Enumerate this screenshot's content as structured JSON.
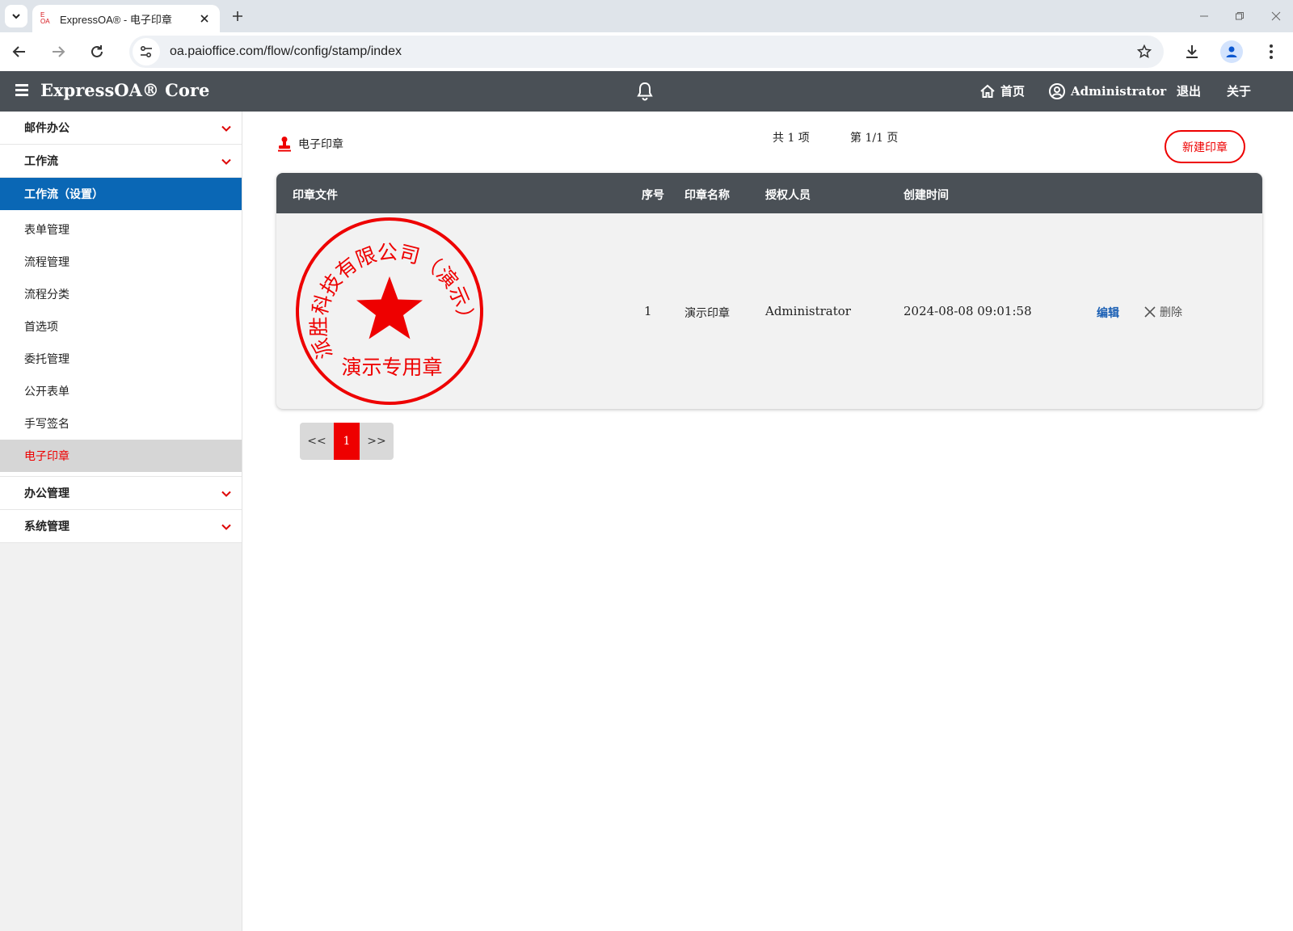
{
  "browser": {
    "tab_title": "ExpressOA® - 电子印章",
    "favicon_text": "E OA",
    "url": "oa.paioffice.com/flow/config/stamp/index"
  },
  "header": {
    "brand": "ExpressOA® Core",
    "home": "首页",
    "user": "Administrator",
    "logout": "退出",
    "about": "关于"
  },
  "sidebar": {
    "groups_top": [
      {
        "label": "邮件办公"
      },
      {
        "label": "工作流"
      }
    ],
    "active_group": "工作流（设置）",
    "sub_items": [
      {
        "label": "表单管理"
      },
      {
        "label": "流程管理"
      },
      {
        "label": "流程分类"
      },
      {
        "label": "首选项"
      },
      {
        "label": "委托管理"
      },
      {
        "label": "公开表单"
      },
      {
        "label": "手写签名"
      },
      {
        "label": "电子印章"
      }
    ],
    "groups_bottom": [
      {
        "label": "办公管理"
      },
      {
        "label": "系统管理"
      }
    ]
  },
  "main": {
    "title": "电子印章",
    "total": "共 1 项",
    "page": "第 1/1 页",
    "new_button": "新建印章",
    "columns": {
      "file": "印章文件",
      "index": "序号",
      "name": "印章名称",
      "authorized": "授权人员",
      "created": "创建时间"
    },
    "rows": [
      {
        "index": "1",
        "name": "演示印章",
        "authorized": "Administrator",
        "created": "2024-08-08 09:01:58",
        "edit": "编辑",
        "delete": "删除",
        "stamp": {
          "arc_text": "派胜科技有限公司（演示）",
          "bottom_text": "演示专用章"
        }
      }
    ],
    "pager": {
      "prev": "<<",
      "current": "1",
      "next": ">>"
    }
  },
  "colors": {
    "header_bg": "#4a5056",
    "accent_blue": "#0a67b5",
    "accent_red": "#e00000"
  }
}
